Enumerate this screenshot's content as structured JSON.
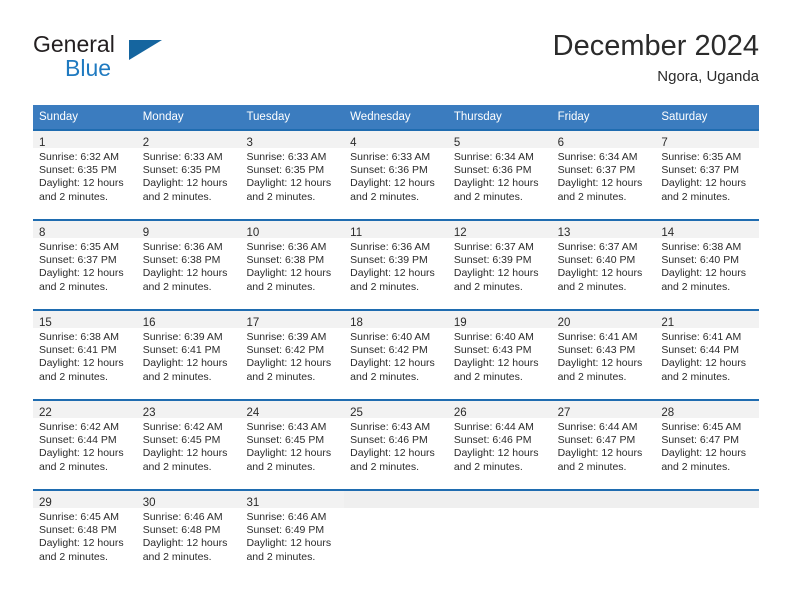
{
  "brand": {
    "name_part1": "General",
    "name_part2": "Blue",
    "flag_icon": "triangle-flag-icon"
  },
  "header": {
    "title": "December 2024",
    "location": "Ngora, Uganda"
  },
  "colors": {
    "header_blue": "#3b7cbf",
    "cell_top_border": "#1f6cb0",
    "brand_blue": "#1f7ac0",
    "daynum_band": "#f2f2f2",
    "text": "#2b2b2b"
  },
  "weekdays": [
    "Sunday",
    "Monday",
    "Tuesday",
    "Wednesday",
    "Thursday",
    "Friday",
    "Saturday"
  ],
  "weeks": [
    [
      {
        "day": "1",
        "sunrise": "Sunrise: 6:32 AM",
        "sunset": "Sunset: 6:35 PM",
        "daylight1": "Daylight: 12 hours",
        "daylight2": "and 2 minutes."
      },
      {
        "day": "2",
        "sunrise": "Sunrise: 6:33 AM",
        "sunset": "Sunset: 6:35 PM",
        "daylight1": "Daylight: 12 hours",
        "daylight2": "and 2 minutes."
      },
      {
        "day": "3",
        "sunrise": "Sunrise: 6:33 AM",
        "sunset": "Sunset: 6:35 PM",
        "daylight1": "Daylight: 12 hours",
        "daylight2": "and 2 minutes."
      },
      {
        "day": "4",
        "sunrise": "Sunrise: 6:33 AM",
        "sunset": "Sunset: 6:36 PM",
        "daylight1": "Daylight: 12 hours",
        "daylight2": "and 2 minutes."
      },
      {
        "day": "5",
        "sunrise": "Sunrise: 6:34 AM",
        "sunset": "Sunset: 6:36 PM",
        "daylight1": "Daylight: 12 hours",
        "daylight2": "and 2 minutes."
      },
      {
        "day": "6",
        "sunrise": "Sunrise: 6:34 AM",
        "sunset": "Sunset: 6:37 PM",
        "daylight1": "Daylight: 12 hours",
        "daylight2": "and 2 minutes."
      },
      {
        "day": "7",
        "sunrise": "Sunrise: 6:35 AM",
        "sunset": "Sunset: 6:37 PM",
        "daylight1": "Daylight: 12 hours",
        "daylight2": "and 2 minutes."
      }
    ],
    [
      {
        "day": "8",
        "sunrise": "Sunrise: 6:35 AM",
        "sunset": "Sunset: 6:37 PM",
        "daylight1": "Daylight: 12 hours",
        "daylight2": "and 2 minutes."
      },
      {
        "day": "9",
        "sunrise": "Sunrise: 6:36 AM",
        "sunset": "Sunset: 6:38 PM",
        "daylight1": "Daylight: 12 hours",
        "daylight2": "and 2 minutes."
      },
      {
        "day": "10",
        "sunrise": "Sunrise: 6:36 AM",
        "sunset": "Sunset: 6:38 PM",
        "daylight1": "Daylight: 12 hours",
        "daylight2": "and 2 minutes."
      },
      {
        "day": "11",
        "sunrise": "Sunrise: 6:36 AM",
        "sunset": "Sunset: 6:39 PM",
        "daylight1": "Daylight: 12 hours",
        "daylight2": "and 2 minutes."
      },
      {
        "day": "12",
        "sunrise": "Sunrise: 6:37 AM",
        "sunset": "Sunset: 6:39 PM",
        "daylight1": "Daylight: 12 hours",
        "daylight2": "and 2 minutes."
      },
      {
        "day": "13",
        "sunrise": "Sunrise: 6:37 AM",
        "sunset": "Sunset: 6:40 PM",
        "daylight1": "Daylight: 12 hours",
        "daylight2": "and 2 minutes."
      },
      {
        "day": "14",
        "sunrise": "Sunrise: 6:38 AM",
        "sunset": "Sunset: 6:40 PM",
        "daylight1": "Daylight: 12 hours",
        "daylight2": "and 2 minutes."
      }
    ],
    [
      {
        "day": "15",
        "sunrise": "Sunrise: 6:38 AM",
        "sunset": "Sunset: 6:41 PM",
        "daylight1": "Daylight: 12 hours",
        "daylight2": "and 2 minutes."
      },
      {
        "day": "16",
        "sunrise": "Sunrise: 6:39 AM",
        "sunset": "Sunset: 6:41 PM",
        "daylight1": "Daylight: 12 hours",
        "daylight2": "and 2 minutes."
      },
      {
        "day": "17",
        "sunrise": "Sunrise: 6:39 AM",
        "sunset": "Sunset: 6:42 PM",
        "daylight1": "Daylight: 12 hours",
        "daylight2": "and 2 minutes."
      },
      {
        "day": "18",
        "sunrise": "Sunrise: 6:40 AM",
        "sunset": "Sunset: 6:42 PM",
        "daylight1": "Daylight: 12 hours",
        "daylight2": "and 2 minutes."
      },
      {
        "day": "19",
        "sunrise": "Sunrise: 6:40 AM",
        "sunset": "Sunset: 6:43 PM",
        "daylight1": "Daylight: 12 hours",
        "daylight2": "and 2 minutes."
      },
      {
        "day": "20",
        "sunrise": "Sunrise: 6:41 AM",
        "sunset": "Sunset: 6:43 PM",
        "daylight1": "Daylight: 12 hours",
        "daylight2": "and 2 minutes."
      },
      {
        "day": "21",
        "sunrise": "Sunrise: 6:41 AM",
        "sunset": "Sunset: 6:44 PM",
        "daylight1": "Daylight: 12 hours",
        "daylight2": "and 2 minutes."
      }
    ],
    [
      {
        "day": "22",
        "sunrise": "Sunrise: 6:42 AM",
        "sunset": "Sunset: 6:44 PM",
        "daylight1": "Daylight: 12 hours",
        "daylight2": "and 2 minutes."
      },
      {
        "day": "23",
        "sunrise": "Sunrise: 6:42 AM",
        "sunset": "Sunset: 6:45 PM",
        "daylight1": "Daylight: 12 hours",
        "daylight2": "and 2 minutes."
      },
      {
        "day": "24",
        "sunrise": "Sunrise: 6:43 AM",
        "sunset": "Sunset: 6:45 PM",
        "daylight1": "Daylight: 12 hours",
        "daylight2": "and 2 minutes."
      },
      {
        "day": "25",
        "sunrise": "Sunrise: 6:43 AM",
        "sunset": "Sunset: 6:46 PM",
        "daylight1": "Daylight: 12 hours",
        "daylight2": "and 2 minutes."
      },
      {
        "day": "26",
        "sunrise": "Sunrise: 6:44 AM",
        "sunset": "Sunset: 6:46 PM",
        "daylight1": "Daylight: 12 hours",
        "daylight2": "and 2 minutes."
      },
      {
        "day": "27",
        "sunrise": "Sunrise: 6:44 AM",
        "sunset": "Sunset: 6:47 PM",
        "daylight1": "Daylight: 12 hours",
        "daylight2": "and 2 minutes."
      },
      {
        "day": "28",
        "sunrise": "Sunrise: 6:45 AM",
        "sunset": "Sunset: 6:47 PM",
        "daylight1": "Daylight: 12 hours",
        "daylight2": "and 2 minutes."
      }
    ],
    [
      {
        "day": "29",
        "sunrise": "Sunrise: 6:45 AM",
        "sunset": "Sunset: 6:48 PM",
        "daylight1": "Daylight: 12 hours",
        "daylight2": "and 2 minutes."
      },
      {
        "day": "30",
        "sunrise": "Sunrise: 6:46 AM",
        "sunset": "Sunset: 6:48 PM",
        "daylight1": "Daylight: 12 hours",
        "daylight2": "and 2 minutes."
      },
      {
        "day": "31",
        "sunrise": "Sunrise: 6:46 AM",
        "sunset": "Sunset: 6:49 PM",
        "daylight1": "Daylight: 12 hours",
        "daylight2": "and 2 minutes."
      },
      {
        "day": "",
        "sunrise": "",
        "sunset": "",
        "daylight1": "",
        "daylight2": ""
      },
      {
        "day": "",
        "sunrise": "",
        "sunset": "",
        "daylight1": "",
        "daylight2": ""
      },
      {
        "day": "",
        "sunrise": "",
        "sunset": "",
        "daylight1": "",
        "daylight2": ""
      },
      {
        "day": "",
        "sunrise": "",
        "sunset": "",
        "daylight1": "",
        "daylight2": ""
      }
    ]
  ]
}
